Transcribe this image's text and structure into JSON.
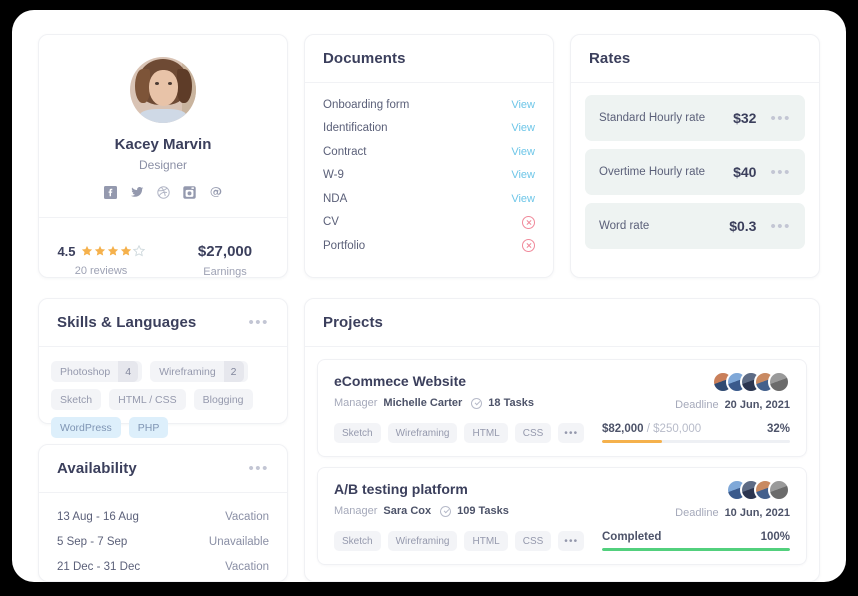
{
  "profile": {
    "name": "Kacey Marvin",
    "role": "Designer",
    "socials": [
      "facebook-icon",
      "twitter-icon",
      "dribbble-icon",
      "instagram-icon",
      "email-at-icon"
    ],
    "rating": "4.5",
    "stars_filled": 4,
    "stars_total": 5,
    "reviews": "20 reviews",
    "earnings": "$27,000",
    "earnings_label": "Earnings"
  },
  "documents": {
    "title": "Documents",
    "view_label": "View",
    "items": [
      {
        "name": "Onboarding form",
        "action": "view"
      },
      {
        "name": "Identification",
        "action": "view"
      },
      {
        "name": "Contract",
        "action": "view"
      },
      {
        "name": "W-9",
        "action": "view"
      },
      {
        "name": "NDA",
        "action": "view"
      },
      {
        "name": "CV",
        "action": "missing"
      },
      {
        "name": "Portfolio",
        "action": "missing"
      }
    ]
  },
  "rates": {
    "title": "Rates",
    "items": [
      {
        "label": "Standard Hourly rate",
        "value": "$32"
      },
      {
        "label": "Overtime Hourly rate",
        "value": "$40"
      },
      {
        "label": "Word rate",
        "value": "$0.3"
      }
    ]
  },
  "skills": {
    "title": "Skills & Languages",
    "menu": "•••",
    "tags": [
      {
        "label": "Photoshop",
        "count": "4",
        "style": "gray"
      },
      {
        "label": "Wireframing",
        "count": "2",
        "style": "gray"
      },
      {
        "label": "Sketch",
        "count": "",
        "style": "gray"
      },
      {
        "label": "HTML / CSS",
        "count": "",
        "style": "gray"
      },
      {
        "label": "Blogging",
        "count": "",
        "style": "gray"
      },
      {
        "label": "WordPress",
        "count": "",
        "style": "blue"
      },
      {
        "label": "PHP",
        "count": "",
        "style": "blue"
      }
    ]
  },
  "availability": {
    "title": "Availability",
    "menu": "•••",
    "items": [
      {
        "range": "13 Aug - 16 Aug",
        "status": "Vacation"
      },
      {
        "range": "5 Sep - 7 Sep",
        "status": "Unavailable"
      },
      {
        "range": "21 Dec - 31 Dec",
        "status": "Vacation"
      }
    ]
  },
  "projects": {
    "title": "Projects",
    "manager_label": "Manager",
    "deadline_label": "Deadline",
    "items": [
      {
        "title": "eCommece Website",
        "manager": "Michelle Carter",
        "tasks": "18 Tasks",
        "deadline": "20 Jun, 2021",
        "tags": [
          "Sketch",
          "Wireframing",
          "HTML",
          "CSS"
        ],
        "tags_more": "•••",
        "budget_current": "$82,000",
        "budget_separator": " / ",
        "budget_total": "$250,000",
        "percent_label": "32%",
        "percent": 32,
        "bar_color": "#f5b14c",
        "avatars": 5
      },
      {
        "title": "A/B testing platform",
        "manager": "Sara Cox",
        "tasks": "109 Tasks",
        "deadline": "10 Jun, 2021",
        "tags": [
          "Sketch",
          "Wireframing",
          "HTML",
          "CSS"
        ],
        "tags_more": "•••",
        "budget_current": "Completed",
        "budget_separator": "",
        "budget_total": "",
        "percent_label": "100%",
        "percent": 100,
        "bar_color": "#52d07d",
        "avatars": 4
      }
    ]
  },
  "colors": {
    "page_bg": "#ffffff",
    "outer_bg": "#000000",
    "heading": "#3b3f5c",
    "muted": "#8a8fa5",
    "link": "#6ec6e8",
    "danger": "#f0899a",
    "star": "#f5b14c",
    "tag_blue": "#ddeffb",
    "rate_row": "#eef3f2"
  }
}
